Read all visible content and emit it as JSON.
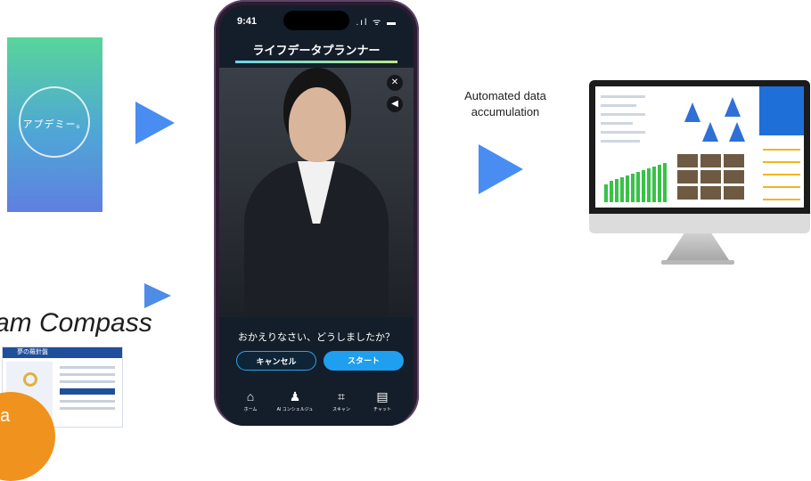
{
  "splash": {
    "logo_text": "アプデミー。"
  },
  "phone": {
    "status_time": "9:41",
    "status_icons": ".ıl ᯤ ▬",
    "app_title": "ライフデータプランナー",
    "question": "おかえりなさい、どうしましたか？",
    "cancel_label": "キャンセル",
    "start_label": "スタート",
    "nav": [
      {
        "icon": "⌂",
        "label": "ホーム"
      },
      {
        "icon": "♟",
        "label": "AI コンシェルジュ"
      },
      {
        "icon": "⌗",
        "label": "スキャン"
      },
      {
        "icon": "▤",
        "label": "チャット"
      }
    ]
  },
  "caption": {
    "line1": "Automated data",
    "line2": "accumulation"
  },
  "dream": {
    "title": "am Compass",
    "thumb_header": "夢の羅針盤",
    "badge_text": "a"
  },
  "colors": {
    "arrow": "#4f8ce8",
    "start": "#1e9ff0",
    "accent_badge": "#f0931e"
  }
}
